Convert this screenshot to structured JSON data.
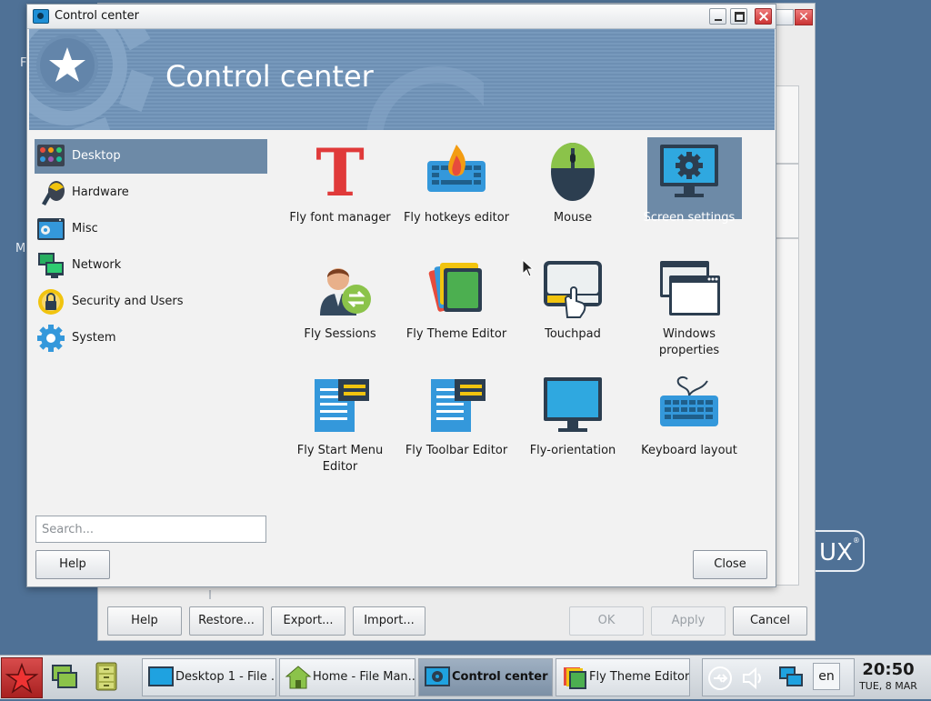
{
  "desktop": {
    "label_f": "F",
    "label_m": "M",
    "brand": "UX",
    "brand_mark": "®"
  },
  "background_dialog": {
    "buttons": {
      "help": "Help",
      "restore": "Restore...",
      "export": "Export...",
      "import": "Import...",
      "ok": "OK",
      "apply": "Apply",
      "cancel": "Cancel"
    }
  },
  "window": {
    "title": "Control center",
    "banner_title": "Control center",
    "sidebar": {
      "items": [
        {
          "label": "Desktop",
          "icon": "desktop-icon"
        },
        {
          "label": "Hardware",
          "icon": "hardware-icon"
        },
        {
          "label": "Misc",
          "icon": "misc-icon"
        },
        {
          "label": "Network",
          "icon": "network-icon"
        },
        {
          "label": "Security and Users",
          "icon": "security-icon"
        },
        {
          "label": "System",
          "icon": "system-gear-icon"
        }
      ],
      "selected": "Desktop"
    },
    "search": {
      "placeholder": "Search..."
    },
    "help_button": "Help",
    "close_button": "Close",
    "tiles": [
      {
        "label": "Fly font manager",
        "icon": "font-icon"
      },
      {
        "label": "Fly hotkeys editor",
        "icon": "hotkeys-keyboard-icon"
      },
      {
        "label": "Mouse",
        "icon": "mouse-icon"
      },
      {
        "label": "Screen settings",
        "icon": "screen-settings-icon"
      },
      {
        "label": "Fly Sessions",
        "icon": "sessions-icon"
      },
      {
        "label": "Fly Theme Editor",
        "icon": "theme-editor-icon"
      },
      {
        "label": "Touchpad",
        "icon": "touchpad-icon"
      },
      {
        "label": "Windows properties",
        "icon": "windows-properties-icon"
      },
      {
        "label": "Fly Start Menu Editor",
        "icon": "start-menu-editor-icon"
      },
      {
        "label": "Fly Toolbar Editor",
        "icon": "toolbar-editor-icon"
      },
      {
        "label": "Fly-orientation",
        "icon": "monitor-icon"
      },
      {
        "label": "Keyboard layout",
        "icon": "keyboard-icon"
      }
    ],
    "selected_tile": "Screen settings"
  },
  "taskbar": {
    "tasks": [
      {
        "label": "Desktop 1 - File ...",
        "active": false
      },
      {
        "label": "Home - File Man...",
        "active": false
      },
      {
        "label": "Control center",
        "active": true
      },
      {
        "label": "Fly Theme Editor",
        "active": false
      }
    ],
    "language": "en",
    "time": "20:50",
    "date": "TUE, 8 MAR"
  },
  "colors": {
    "accent": "#6d8aa7",
    "desktop": "#4f7196",
    "banner": "#7799bc"
  }
}
